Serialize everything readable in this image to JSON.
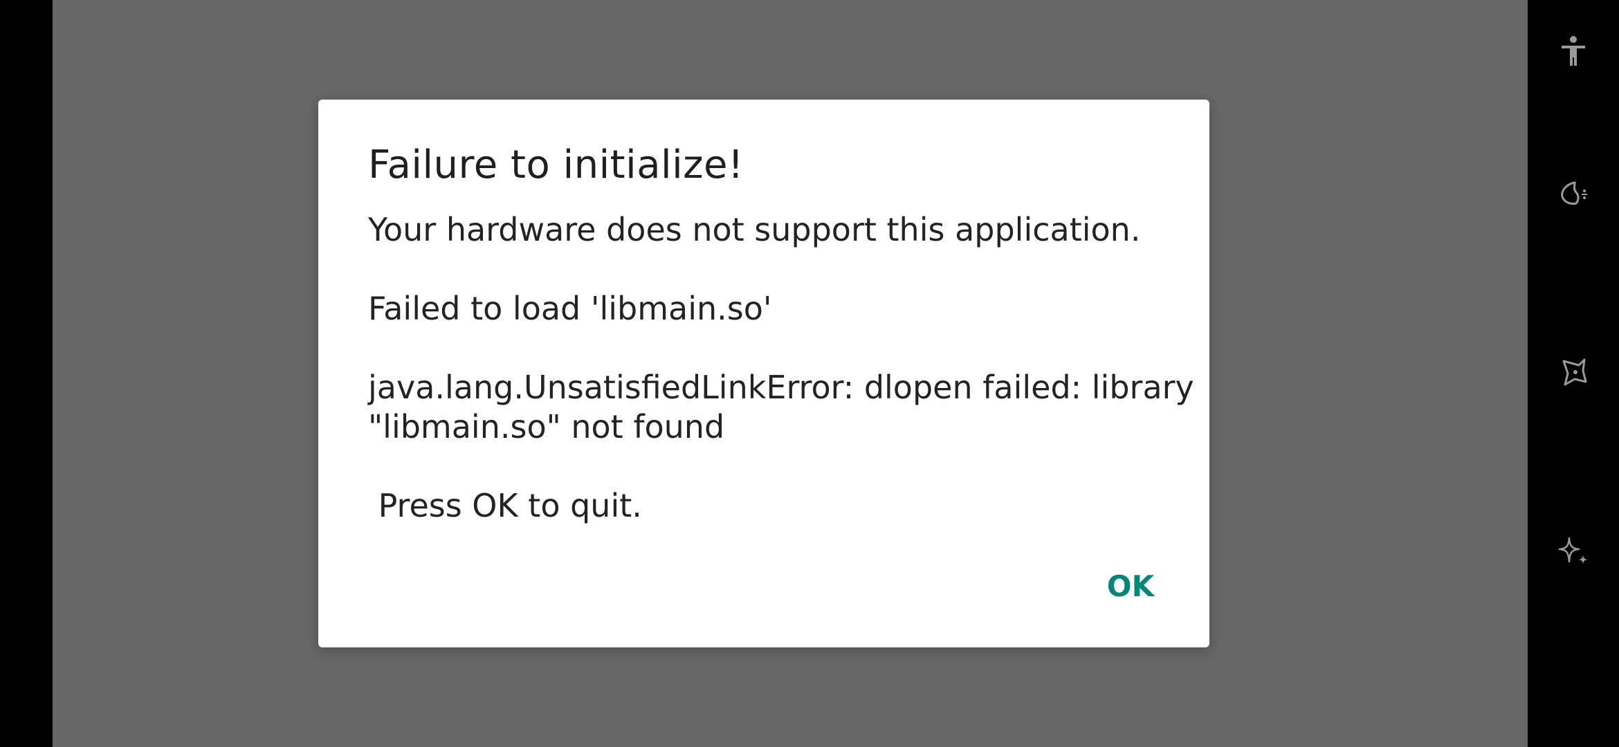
{
  "dialog": {
    "title": "Failure to initialize!",
    "message_lines": [
      "Your hardware does not support this application.",
      "",
      "Failed to load 'libmain.so'",
      "",
      "java.lang.UnsatisfiedLinkError: dlopen failed: library",
      "\"libmain.so\" not found",
      "",
      " Press OK to quit."
    ],
    "ok_label": "OK"
  },
  "side_panel": {
    "icons": [
      "accessibility-icon",
      "smart-sidebar-icon",
      "game-assistant-icon",
      "sparkle-icon"
    ]
  },
  "colors": {
    "scrim": "#676767",
    "dialog_bg": "#ffffff",
    "accent": "#00877a",
    "side_panel_bg": "#000000",
    "icon": "#9a9a9a"
  }
}
